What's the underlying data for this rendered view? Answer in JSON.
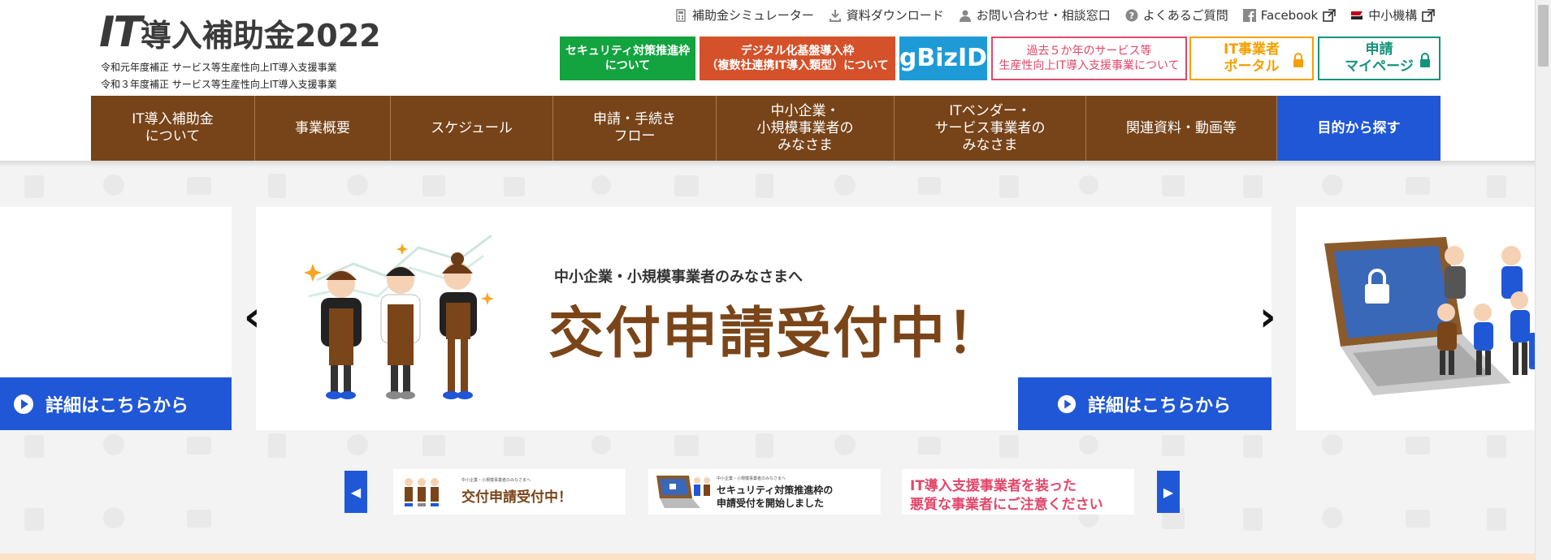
{
  "header": {
    "logo": {
      "it": "IT",
      "rest": "導入補助金2022"
    },
    "subtitle_lines": [
      "令和元年度補正 サービス等生産性向上IT導入支援事業",
      "令和３年度補正 サービス等生産性向上IT導入支援事業"
    ],
    "utility_links": [
      {
        "label": "補助金シミュレーター",
        "icon": "calculator-icon"
      },
      {
        "label": "資料ダウンロード",
        "icon": "download-icon"
      },
      {
        "label": "お問い合わせ・相談窓口",
        "icon": "person-icon"
      },
      {
        "label": "よくあるご質問",
        "icon": "question-icon"
      },
      {
        "label": "Facebook",
        "icon": "facebook-icon"
      },
      {
        "label": "中小機構",
        "icon": "flag-icon"
      }
    ],
    "buttons": [
      {
        "line1": "セキュリティ対策推進枠",
        "line2": "について",
        "bg": "#13a33f",
        "color": "#ffffff"
      },
      {
        "line1": "デジタル化基盤導入枠",
        "line2": "（複数社連携IT導入類型）について",
        "bg": "#d4512a",
        "color": "#ffffff"
      },
      {
        "line1": "gBizID",
        "line2": "",
        "bg": "#1e9bd7",
        "color": "#ffffff"
      },
      {
        "line1": "過去５か年のサービス等",
        "line2": "生産性向上IT導入支援事業について",
        "bg": "#ffffff",
        "color": "#e2476a",
        "border": "#e2476a"
      },
      {
        "line1": "IT事業者",
        "line2": "ポータル",
        "bg": "#ffffff",
        "color": "#f5a000",
        "border": "#f5a000"
      },
      {
        "line1": "申請",
        "line2": "マイページ",
        "bg": "#ffffff",
        "color": "#14937a",
        "border": "#14937a"
      }
    ]
  },
  "nav": [
    {
      "lines": [
        "IT導入補助金",
        "について"
      ]
    },
    {
      "lines": [
        "事業概要"
      ]
    },
    {
      "lines": [
        "スケジュール"
      ]
    },
    {
      "lines": [
        "申請・手続き",
        "フロー"
      ]
    },
    {
      "lines": [
        "中小企業・",
        "小規模事業者の",
        "みなさま"
      ]
    },
    {
      "lines": [
        "ITベンダー・",
        "サービス事業者の",
        "みなさま"
      ]
    },
    {
      "lines": [
        "関連資料・動画等"
      ]
    },
    {
      "lines": [
        "目的から探す"
      ]
    }
  ],
  "carousel": {
    "main_sub": "中小企業・小規模事業者のみなさまへ",
    "main_title": "交付申請受付中！",
    "detail_label": "詳細はこちらから",
    "prev": "‹",
    "next": "›"
  },
  "thumbs": {
    "t1_small": "中小企業・小規模事業者のみなさまへ",
    "t1": "交付申請受付中！",
    "t2_small": "中小企業・小規模事業者のみなさまへ",
    "t2a": "セキュリティ対策推進枠の",
    "t2b": "申請受付を開始しました",
    "t3a": "IT導入支援事業者を装った",
    "t3b": "悪質な事業者にご注意ください",
    "prev": "◀",
    "next": "▶"
  },
  "colors": {
    "brown": "#774318",
    "blue": "#1f57d6",
    "pink": "#e2476a"
  }
}
